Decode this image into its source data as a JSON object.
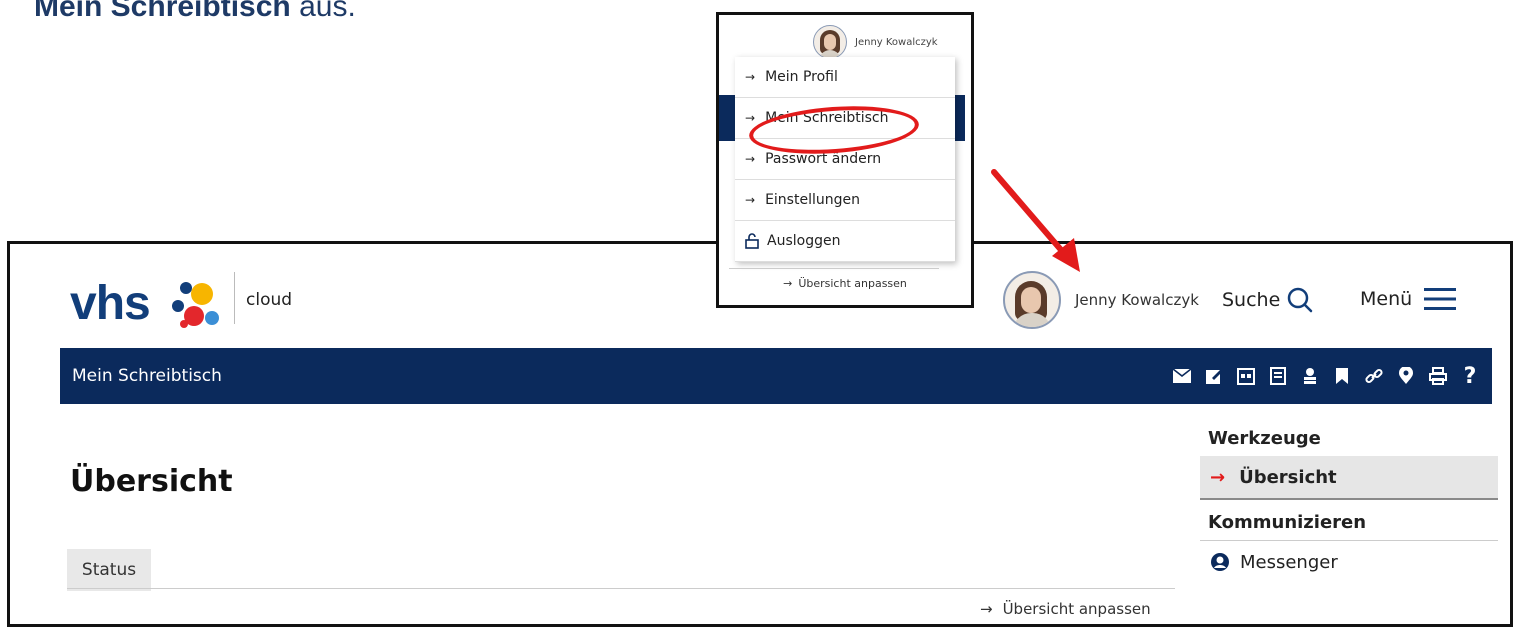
{
  "instruction": {
    "bold": "Mein Schreibtisch",
    "rest": " aus."
  },
  "header": {
    "logo_text": "vhs",
    "logo_suffix": "cloud",
    "user_name": "Jenny Kowalczyk",
    "search_label": "Suche",
    "menu_label": "Menü"
  },
  "bluebar": {
    "title": "Mein Schreibtisch",
    "tool_icons": [
      "mail-icon",
      "edit-icon",
      "calendar-icon",
      "notes-icon",
      "people-icon",
      "bookmark-icon",
      "link-icon",
      "location-icon",
      "print-icon",
      "help-icon"
    ]
  },
  "main": {
    "heading": "Übersicht",
    "tab_status": "Status",
    "adjust_link": "Übersicht anpassen"
  },
  "sidebar": {
    "section_tools": "Werkzeuge",
    "item_overview": "Übersicht",
    "section_communicate": "Kommunizieren",
    "item_messenger": "Messenger"
  },
  "popup": {
    "user_name": "Jenny Kowalczyk",
    "items": [
      {
        "label": "Mein Profil",
        "icon": "arrow-right-icon"
      },
      {
        "label": "Mein Schreibtisch",
        "icon": "arrow-right-icon"
      },
      {
        "label": "Passwort ändern",
        "icon": "arrow-right-icon"
      },
      {
        "label": "Einstellungen",
        "icon": "arrow-right-icon"
      },
      {
        "label": "Ausloggen",
        "icon": "unlock-icon"
      }
    ],
    "footer_link": "Übersicht anpassen"
  },
  "colors": {
    "brand_blue": "#0b2a5c",
    "highlight_red": "#e21b1b"
  }
}
